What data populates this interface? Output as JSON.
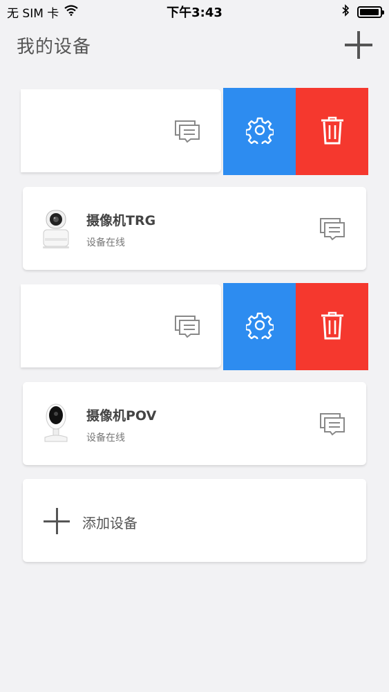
{
  "status_bar": {
    "carrier": "无 SIM 卡",
    "time": "下午3:43",
    "battery_level": 0.95
  },
  "header": {
    "title": "我的设备",
    "add_icon": "plus-icon"
  },
  "swipe_rows": [
    {
      "message_icon": "message-icon",
      "settings_icon": "gear-icon",
      "delete_icon": "trash-icon"
    },
    {
      "message_icon": "message-icon",
      "settings_icon": "gear-icon",
      "delete_icon": "trash-icon"
    }
  ],
  "devices": [
    {
      "name": "摄像机TRG",
      "status": "设备在线",
      "icon": "message-icon"
    },
    {
      "name": "摄像机POV",
      "status": "设备在线",
      "icon": "message-icon"
    }
  ],
  "add_device": {
    "label": "添加设备",
    "icon": "plus-icon"
  },
  "colors": {
    "settings_action": "#2d8cf0",
    "delete_action": "#f5382e",
    "background": "#f2f2f4"
  }
}
